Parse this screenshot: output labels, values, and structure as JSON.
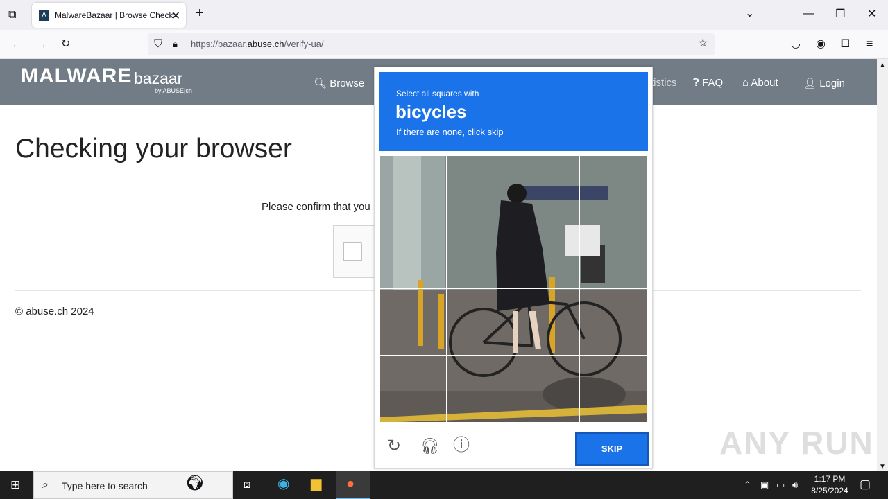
{
  "browser": {
    "tab_title": "MalwareBazaar | Browse Checki",
    "new_tab": "+",
    "close": "✕",
    "url_prefix": "https://bazaar.",
    "url_domain": "abuse.ch",
    "url_path": "/verify-ua/"
  },
  "site": {
    "logo_main": "MALWARE",
    "logo_sub": "bazaar",
    "logo_by": "by ABUSE|ch",
    "nav": {
      "browse": "Browse",
      "statistics": "tistics",
      "faq": "FAQ",
      "about": "About",
      "login": "Login"
    },
    "heading": "Checking your browser",
    "confirm_text": "Please confirm that you",
    "footer": "© abuse.ch 2024"
  },
  "captcha": {
    "instruction": "Select all squares with",
    "target": "bicycles",
    "hint": "If there are none, click skip",
    "skip_label": "SKIP",
    "accent_color": "#1a73e8"
  },
  "watermark": "ANY RUN",
  "taskbar": {
    "search_placeholder": "Type here to search",
    "time": "1:17 PM",
    "date": "8/25/2024"
  }
}
